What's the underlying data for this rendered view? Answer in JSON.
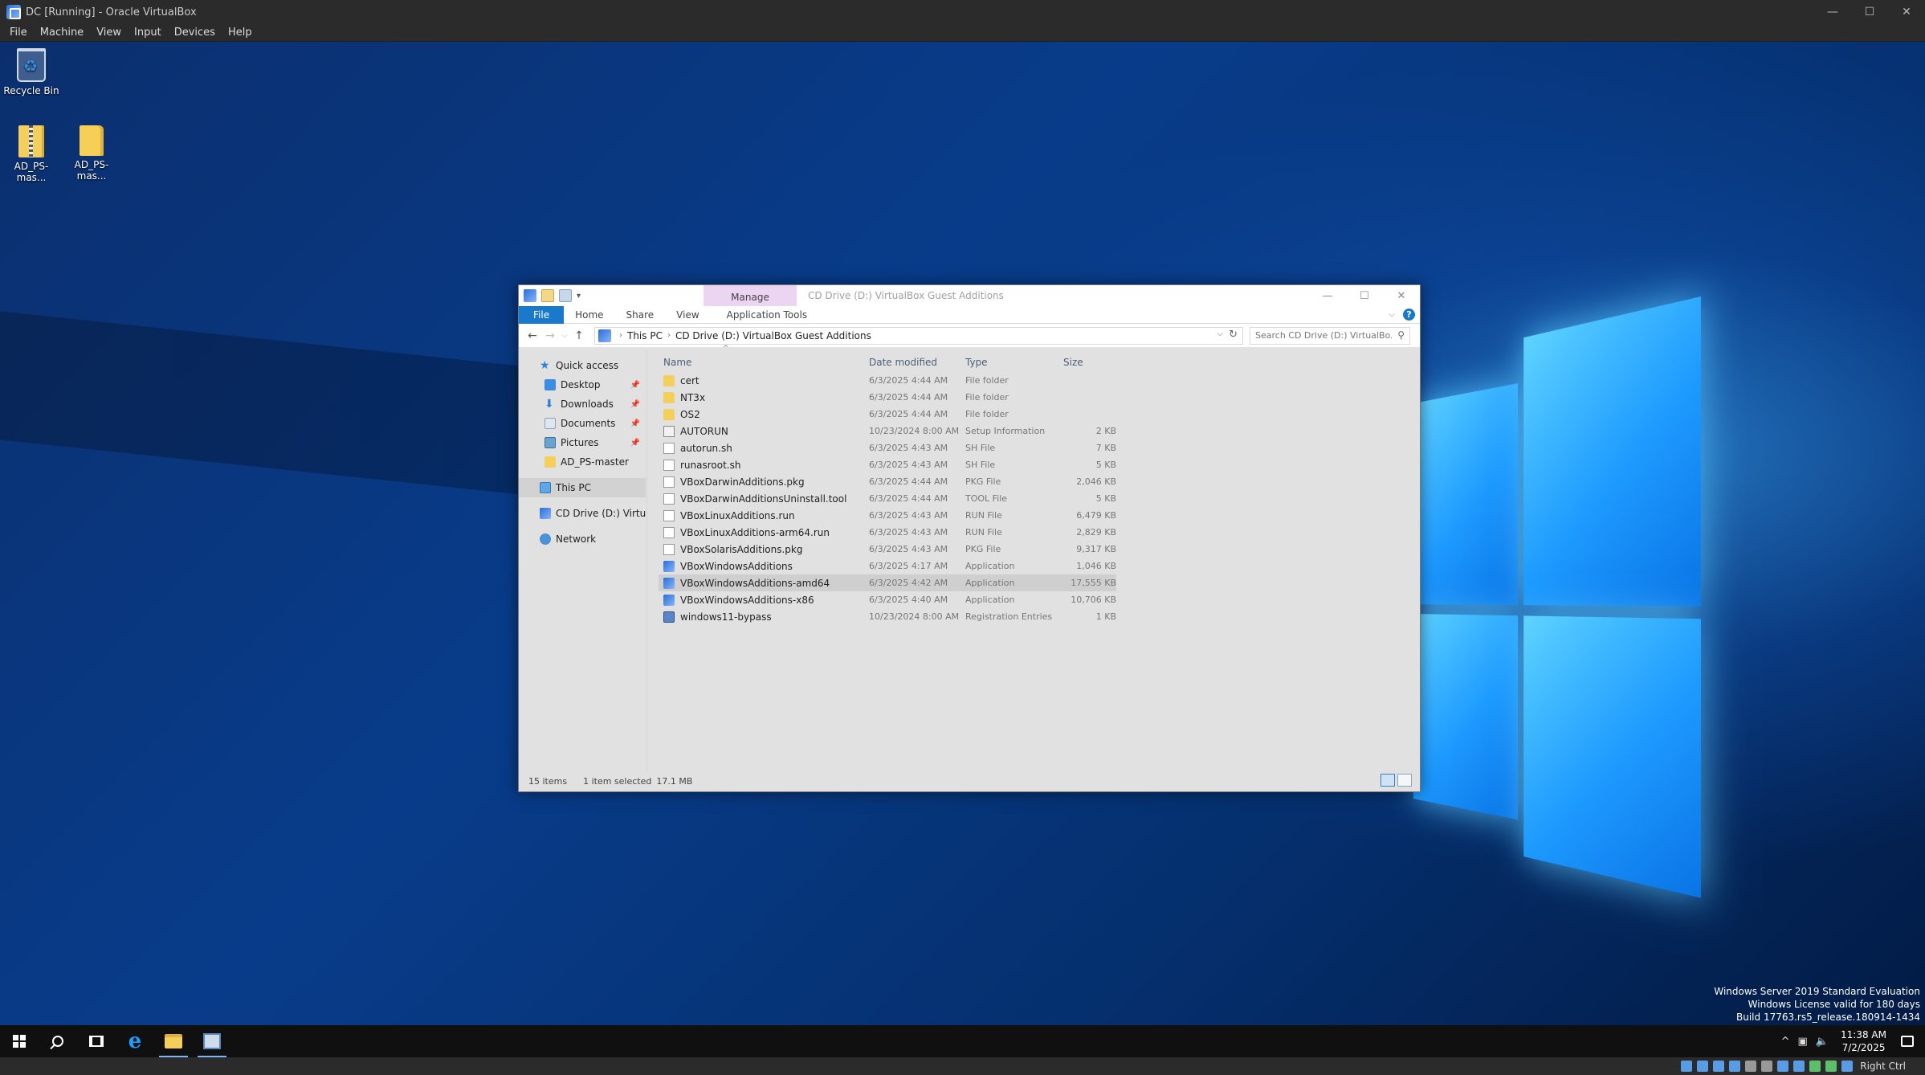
{
  "vbox": {
    "title": "DC [Running] - Oracle VirtualBox",
    "menu": [
      "File",
      "Machine",
      "View",
      "Input",
      "Devices",
      "Help"
    ],
    "window_buttons": [
      "—",
      "☐",
      "✕"
    ],
    "status_host_key": "Right Ctrl"
  },
  "desktop": {
    "icons": [
      {
        "label": "Recycle Bin",
        "icon": "recycle-bin-icon"
      },
      {
        "label": "AD_PS-mas...",
        "icon": "zip-folder-icon"
      },
      {
        "label": "AD_PS-mas...",
        "icon": "folder-icon"
      }
    ],
    "watermark": [
      "Windows Server 2019 Standard Evaluation",
      "Windows License valid for 180 days",
      "Build 17763.rs5_release.180914-1434"
    ]
  },
  "explorer": {
    "title": "CD Drive (D:) VirtualBox Guest Additions",
    "manage_tab": "Manage",
    "window_buttons": [
      "—",
      "☐",
      "✕"
    ],
    "ribbon_tabs": [
      "File",
      "Home",
      "Share",
      "View",
      "Application Tools"
    ],
    "help": "?",
    "breadcrumb": [
      "This PC",
      "CD Drive (D:) VirtualBox Guest Additions"
    ],
    "search_placeholder": "Search CD Drive (D:) VirtualBo...",
    "nav": {
      "quick_access": "Quick access",
      "quick_items": [
        {
          "label": "Desktop",
          "pinned": true
        },
        {
          "label": "Downloads",
          "pinned": true
        },
        {
          "label": "Documents",
          "pinned": true
        },
        {
          "label": "Pictures",
          "pinned": true
        },
        {
          "label": "AD_PS-master",
          "pinned": false
        }
      ],
      "this_pc": "This PC",
      "cd_drive": "CD Drive (D:) VirtualB",
      "network": "Network"
    },
    "columns": {
      "name": "Name",
      "date": "Date modified",
      "type": "Type",
      "size": "Size"
    },
    "files": [
      {
        "name": "cert",
        "date": "6/3/2025 4:44 AM",
        "type": "File folder",
        "size": "",
        "icon": "folder"
      },
      {
        "name": "NT3x",
        "date": "6/3/2025 4:44 AM",
        "type": "File folder",
        "size": "",
        "icon": "folder"
      },
      {
        "name": "OS2",
        "date": "6/3/2025 4:44 AM",
        "type": "File folder",
        "size": "",
        "icon": "folder"
      },
      {
        "name": "AUTORUN",
        "date": "10/23/2024 8:00 AM",
        "type": "Setup Information",
        "size": "2 KB",
        "icon": "setup"
      },
      {
        "name": "autorun.sh",
        "date": "6/3/2025 4:43 AM",
        "type": "SH File",
        "size": "7 KB",
        "icon": "file"
      },
      {
        "name": "runasroot.sh",
        "date": "6/3/2025 4:43 AM",
        "type": "SH File",
        "size": "5 KB",
        "icon": "file"
      },
      {
        "name": "VBoxDarwinAdditions.pkg",
        "date": "6/3/2025 4:44 AM",
        "type": "PKG File",
        "size": "2,046 KB",
        "icon": "file"
      },
      {
        "name": "VBoxDarwinAdditionsUninstall.tool",
        "date": "6/3/2025 4:44 AM",
        "type": "TOOL File",
        "size": "5 KB",
        "icon": "file"
      },
      {
        "name": "VBoxLinuxAdditions.run",
        "date": "6/3/2025 4:43 AM",
        "type": "RUN File",
        "size": "6,479 KB",
        "icon": "file"
      },
      {
        "name": "VBoxLinuxAdditions-arm64.run",
        "date": "6/3/2025 4:43 AM",
        "type": "RUN File",
        "size": "2,829 KB",
        "icon": "file"
      },
      {
        "name": "VBoxSolarisAdditions.pkg",
        "date": "6/3/2025 4:43 AM",
        "type": "PKG File",
        "size": "9,317 KB",
        "icon": "file"
      },
      {
        "name": "VBoxWindowsAdditions",
        "date": "6/3/2025 4:17 AM",
        "type": "Application",
        "size": "1,046 KB",
        "icon": "app"
      },
      {
        "name": "VBoxWindowsAdditions-amd64",
        "date": "6/3/2025 4:42 AM",
        "type": "Application",
        "size": "17,555 KB",
        "icon": "app",
        "selected": true
      },
      {
        "name": "VBoxWindowsAdditions-x86",
        "date": "6/3/2025 4:40 AM",
        "type": "Application",
        "size": "10,706 KB",
        "icon": "app"
      },
      {
        "name": "windows11-bypass",
        "date": "10/23/2024 8:00 AM",
        "type": "Registration Entries",
        "size": "1 KB",
        "icon": "reg"
      }
    ],
    "status": {
      "count": "15 items",
      "selected": "1 item selected",
      "size": "17.1 MB"
    }
  },
  "taskbar": {
    "clock_time": "11:38 AM",
    "clock_date": "7/2/2025"
  }
}
